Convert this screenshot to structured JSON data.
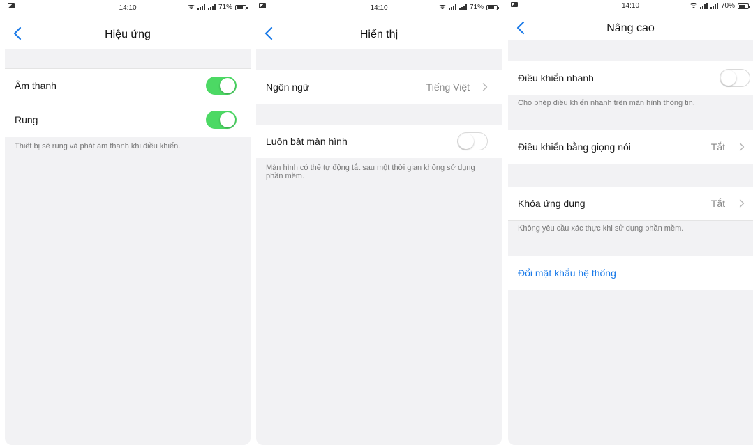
{
  "status_bar": {
    "time": "14:10",
    "battery_1": "71%",
    "battery_2": "71%",
    "battery_3": "70%",
    "battery_fill_1": 0.71,
    "battery_fill_2": 0.71,
    "battery_fill_3": 0.7
  },
  "icons": {
    "back": "chevron-left-icon",
    "chevron": "chevron-right-icon",
    "wifi": "wifi-icon",
    "signal": "signal-icon",
    "battery": "battery-icon"
  },
  "colors": {
    "toggle_on": "#4cd964",
    "link": "#1a7ae8",
    "back_arrow": "#1a7ae8"
  },
  "screen1": {
    "title": "Hiệu ứng",
    "sound_label": "Âm thanh",
    "sound_on": true,
    "vibrate_label": "Rung",
    "vibrate_on": true,
    "note": "Thiết bị sẽ rung và phát âm thanh khi điều khiển."
  },
  "screen2": {
    "title": "Hiển thị",
    "language_label": "Ngôn ngữ",
    "language_value": "Tiếng Việt",
    "screen_on_label": "Luôn bật màn hình",
    "screen_on": false,
    "note": "Màn hình có thể tự động tắt sau một thời gian không sử dụng phần mềm."
  },
  "screen3": {
    "title": "Nâng cao",
    "quick_control_label": "Điều khiển nhanh",
    "quick_control_on": false,
    "quick_control_note": "Cho phép điều khiển nhanh trên màn hình thông tin.",
    "voice_control_label": "Điều khiển bằng giọng nói",
    "voice_control_value": "Tắt",
    "app_lock_label": "Khóa ứng dụng",
    "app_lock_value": "Tắt",
    "app_lock_note": "Không yêu cầu xác thực khi sử dụng phần mềm.",
    "change_password_label": "Đổi mật khẩu hệ thống"
  }
}
